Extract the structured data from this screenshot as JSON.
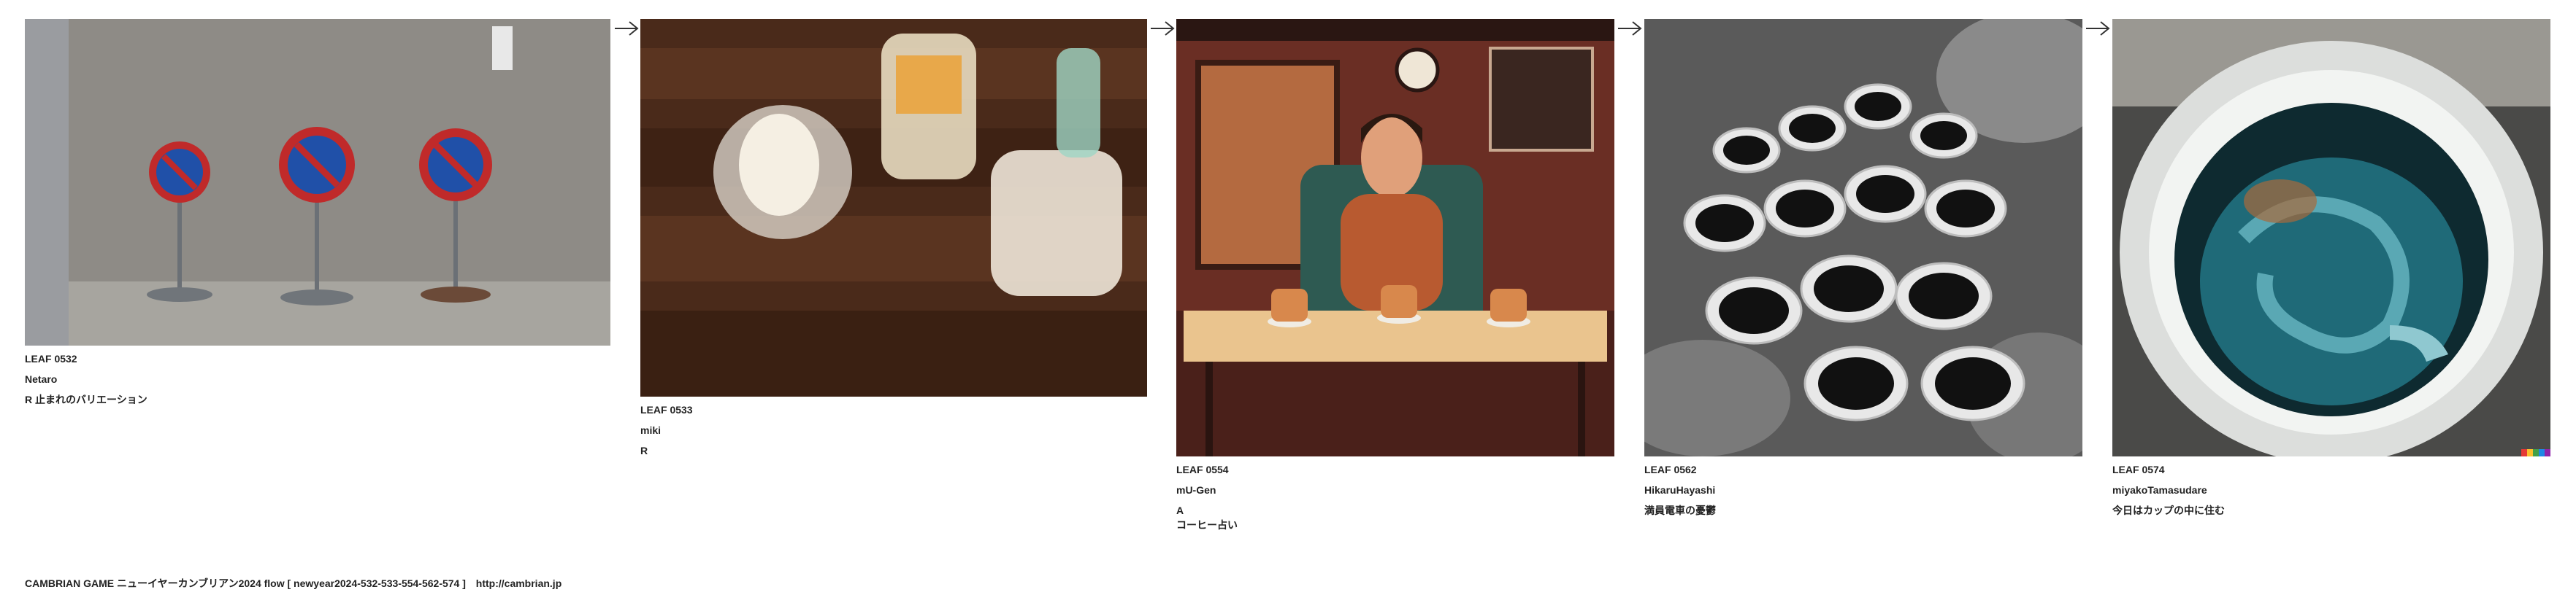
{
  "leaves": [
    {
      "id": "LEAF 0532",
      "author": "Netaro",
      "lines": [
        "R 止まれのバリエーション"
      ]
    },
    {
      "id": "LEAF 0533",
      "author": "miki",
      "lines": [
        "R"
      ]
    },
    {
      "id": "LEAF 0554",
      "author": "mU-Gen",
      "lines": [
        "A",
        "コーヒー占い"
      ]
    },
    {
      "id": "LEAF 0562",
      "author": "HikaruHayashi",
      "lines": [
        "満員電車の憂鬱"
      ]
    },
    {
      "id": "LEAF 0574",
      "author": "miyakoTamasudare",
      "lines": [
        "今日はカップの中に住む"
      ]
    }
  ],
  "footer": {
    "title": "CAMBRIAN GAME  ニューイヤーカンブリアン2024  flow [ newyear2024-532-533-554-562-574 ]",
    "link": "http://cambrian.jp"
  },
  "icons": {
    "arrow": "right-arrow-icon"
  }
}
